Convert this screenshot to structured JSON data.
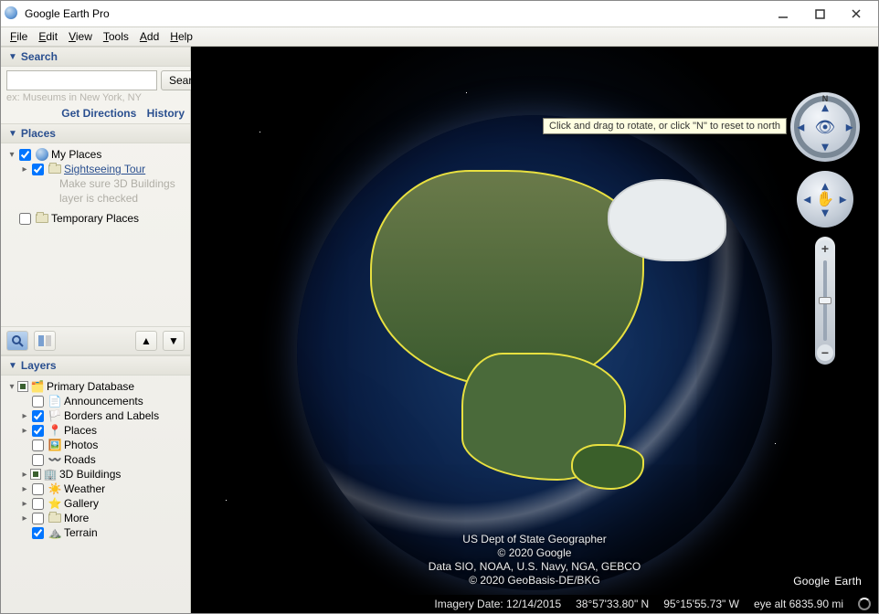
{
  "window": {
    "title": "Google Earth Pro"
  },
  "menu": [
    "File",
    "Edit",
    "View",
    "Tools",
    "Add",
    "Help"
  ],
  "sidebar": {
    "search": {
      "header": "Search",
      "button": "Search",
      "placeholder": "ex: Museums in New York, NY",
      "directions": "Get Directions",
      "history": "History"
    },
    "places": {
      "header": "Places",
      "my_places": "My Places",
      "sightseeing": "Sightseeing Tour",
      "sightseeing_hint1": "Make sure 3D Buildings",
      "sightseeing_hint2": "layer is checked",
      "temporary": "Temporary Places"
    },
    "layers": {
      "header": "Layers",
      "primary": "Primary Database",
      "items": [
        "Announcements",
        "Borders and Labels",
        "Places",
        "Photos",
        "Roads",
        "3D Buildings",
        "Weather",
        "Gallery",
        "More",
        "Terrain"
      ]
    }
  },
  "tooltip": "Click and drag to rotate, or click \"N\" to reset to north",
  "compass_n": "N",
  "attribution": {
    "line1": "US Dept of State Geographer",
    "line2": "© 2020 Google",
    "line3": "Data SIO, NOAA, U.S. Navy, NGA, GEBCO",
    "line4": "© 2020 GeoBasis-DE/BKG"
  },
  "logo": "Google Earth",
  "status": {
    "imagery": "Imagery Date: 12/14/2015",
    "lat": "38°57'33.80\" N",
    "lon": "95°15'55.73\" W",
    "alt": "eye alt 6835.90 mi"
  }
}
